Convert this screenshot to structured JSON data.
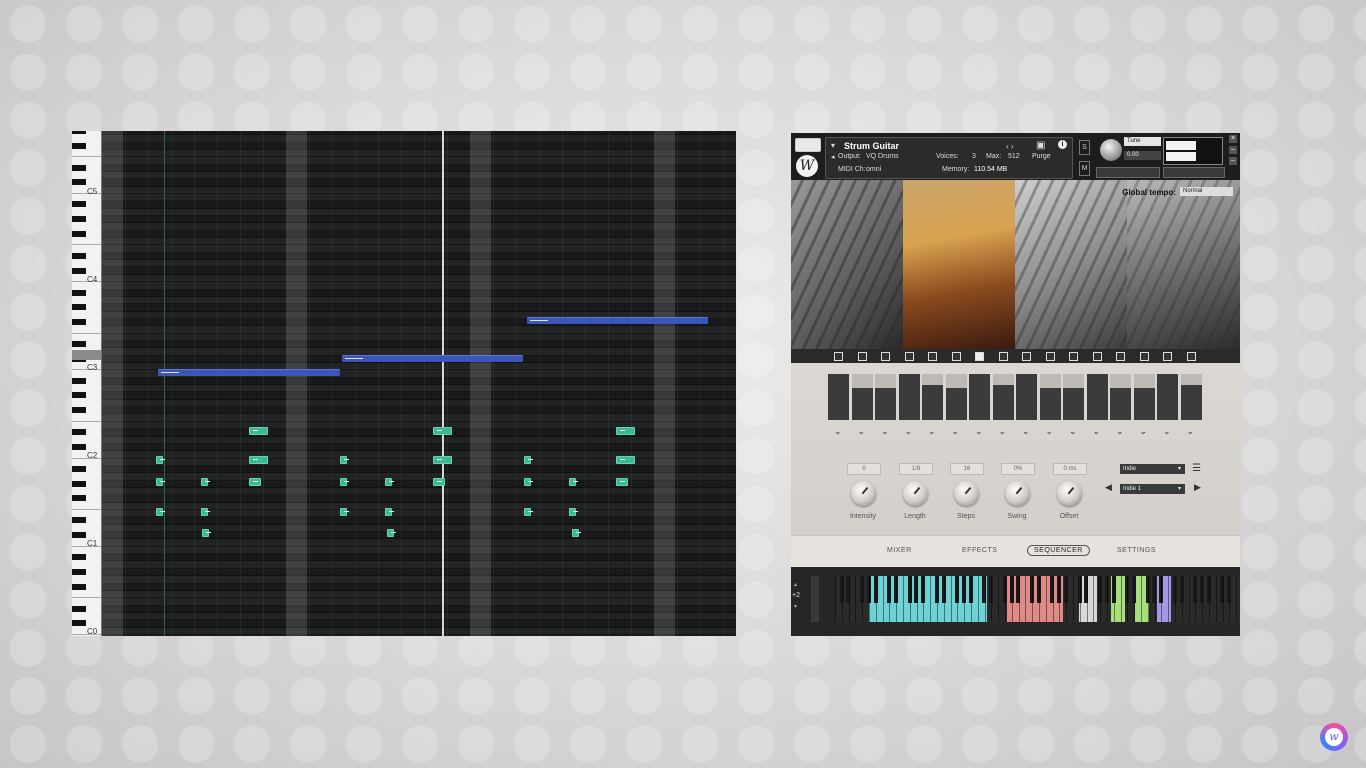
{
  "piano_roll": {
    "octave_labels": [
      "C5",
      "C4",
      "C3",
      "C2",
      "C1",
      "C0"
    ]
  },
  "plugin": {
    "instrument_name": "Strum Guitar",
    "output_label": "Output:",
    "output_value": "VQ Drums",
    "midi_label": "MIDI Ch:",
    "midi_value": "omni",
    "voices_label": "Voices:",
    "voices_value": "3",
    "max_label": "Max:",
    "max_value": "512",
    "purge_label": "Purge",
    "memory_label": "Memory:",
    "memory_value": "110.54 MB",
    "tune_label": "Tune",
    "tune_value": "0.00",
    "s_label": "S",
    "m_label": "M",
    "global_tempo_label": "Global tempo:",
    "global_tempo_value": "Normal",
    "knobs": [
      {
        "value": "0",
        "label": "Intensity"
      },
      {
        "value": "1/8",
        "label": "Length"
      },
      {
        "value": "16",
        "label": "Steps"
      },
      {
        "value": "0%",
        "label": "Swing"
      },
      {
        "value": "0 ms",
        "label": "Offset"
      }
    ],
    "preset_category": "Indie",
    "preset_name": "Indie 1",
    "tabs": [
      "MIXER",
      "EFFECTS",
      "SEQUENCER",
      "SETTINGS"
    ],
    "active_tab": "SEQUENCER",
    "octave_shift": "+2",
    "step_levels": [
      1.0,
      0.7,
      0.7,
      1.0,
      0.75,
      0.7,
      1.0,
      0.75,
      1.0,
      0.7,
      0.7,
      1.0,
      0.7,
      0.7,
      1.0,
      0.75
    ],
    "colors": {
      "zone_cyan": "#6fd3d6",
      "zone_red": "#e08a88",
      "zone_gray": "#d8d8d8",
      "zone_green": "#a7e07a",
      "zone_purple": "#a597e6"
    }
  }
}
